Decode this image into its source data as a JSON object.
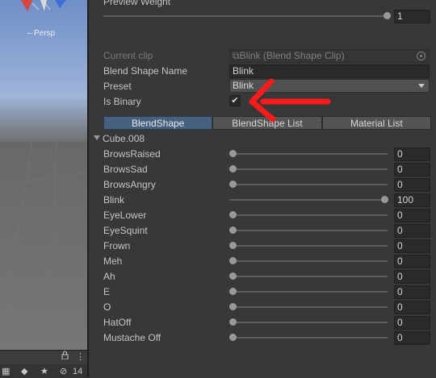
{
  "scene": {
    "gizmo_label": "Persp",
    "footer": {
      "lock_icon": "lock-icon",
      "menu_icon": "kebab-menu-icon",
      "hidden_count": "14"
    }
  },
  "inspector": {
    "preview_weight": {
      "label": "Preview Weight",
      "value": "1",
      "fraction": 1.0
    },
    "current_clip": {
      "label": "Current clip",
      "value": "⧉Blink (Blend Shape Clip)"
    },
    "blend_shape_name": {
      "label": "Blend Shape Name",
      "value": "Blink"
    },
    "preset": {
      "label": "Preset",
      "value": "Blink"
    },
    "is_binary": {
      "label": "Is Binary",
      "checked": true,
      "mark": "✔"
    },
    "tabs": [
      {
        "label": "BlendShape",
        "active": true
      },
      {
        "label": "BlendShape List",
        "active": false
      },
      {
        "label": "Material List",
        "active": false
      }
    ],
    "foldout": {
      "label": "Cube.008"
    },
    "blend_shapes": [
      {
        "name": "BrowsRaised",
        "value": "0",
        "fraction": 0.0
      },
      {
        "name": "BrowsSad",
        "value": "0",
        "fraction": 0.0
      },
      {
        "name": "BrowsAngry",
        "value": "0",
        "fraction": 0.0
      },
      {
        "name": "Blink",
        "value": "100",
        "fraction": 1.0
      },
      {
        "name": "EyeLower",
        "value": "0",
        "fraction": 0.0
      },
      {
        "name": "EyeSquint",
        "value": "0",
        "fraction": 0.0
      },
      {
        "name": "Frown",
        "value": "0",
        "fraction": 0.0
      },
      {
        "name": "Meh",
        "value": "0",
        "fraction": 0.0
      },
      {
        "name": "Ah",
        "value": "0",
        "fraction": 0.0
      },
      {
        "name": "E",
        "value": "0",
        "fraction": 0.0
      },
      {
        "name": "O",
        "value": "0",
        "fraction": 0.0
      },
      {
        "name": "HatOff",
        "value": "0",
        "fraction": 0.0
      },
      {
        "name": "Mustache Off",
        "value": "0",
        "fraction": 0.0
      }
    ]
  },
  "colors": {
    "annotation_arrow": "#ff1a1a",
    "active_tab": "#46607f",
    "panel_bg": "#383838"
  }
}
